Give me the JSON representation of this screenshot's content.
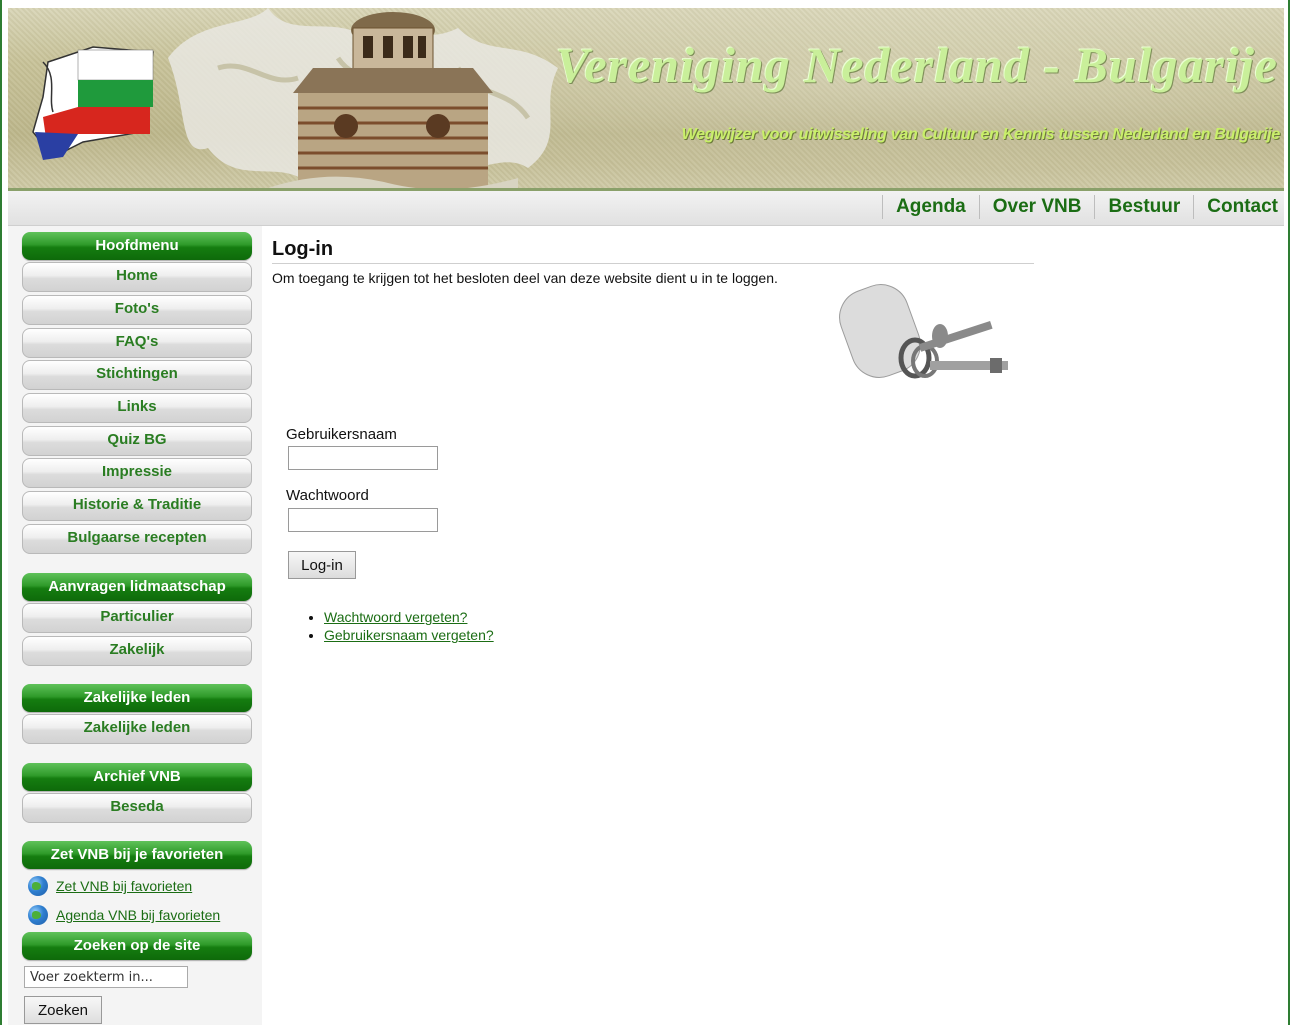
{
  "header": {
    "title": "Vereniging Nederland - Bulgarije",
    "subtitle": "Wegwijzer voor uitwisseling van Cultuur en Kennis tussen Nederland en Bulgarije"
  },
  "topnav": [
    "Agenda",
    "Over VNB",
    "Bestuur",
    "Contact"
  ],
  "sidebar": {
    "hoofdmenu": {
      "title": "Hoofdmenu",
      "items": [
        "Home",
        "Foto's",
        "FAQ's",
        "Stichtingen",
        "Links",
        "Quiz BG",
        "Impressie",
        "Historie & Traditie",
        "Bulgaarse recepten"
      ]
    },
    "lidmaatschap": {
      "title": "Aanvragen lidmaatschap",
      "items": [
        "Particulier",
        "Zakelijk"
      ]
    },
    "zakelijk": {
      "title": "Zakelijke leden",
      "items": [
        "Zakelijke leden"
      ]
    },
    "archief": {
      "title": "Archief VNB",
      "items": [
        "Beseda"
      ]
    },
    "favorieten": {
      "title": "Zet VNB bij je favorieten",
      "links": [
        "Zet VNB bij favorieten",
        "Agenda VNB bij favorieten"
      ]
    },
    "zoeken": {
      "title": "Zoeken op de site",
      "input_value": "Voer zoekterm in...",
      "button": "Zoeken"
    }
  },
  "main": {
    "title": "Log-in",
    "intro": "Om toegang te krijgen tot het besloten deel van deze website dient u in te loggen.",
    "username_label": "Gebruikersnaam",
    "password_label": "Wachtwoord",
    "login_button": "Log-in",
    "links": [
      "Wachtwoord vergeten?",
      "Gebruikersnaam vergeten?"
    ]
  }
}
